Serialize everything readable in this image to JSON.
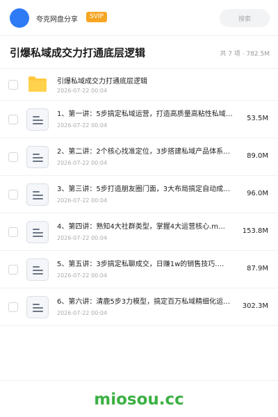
{
  "header": {
    "username": "夸克网盘分享",
    "badge": "SVIP",
    "search_placeholder": "搜索"
  },
  "folder": {
    "title": "引爆私域成交力打通底层逻辑",
    "summary": "共 7 项 · 782.5M"
  },
  "files": [
    {
      "icon": "folder-icon",
      "name": "引爆私域成交力打通底层逻辑",
      "date": "2026-07-22 00:04",
      "size": ""
    },
    {
      "icon": "document-icon",
      "name": "1、第一讲：5步搞定私域运营，打造高质量高粘性私域…",
      "date": "2026-07-22 00:04",
      "size": "53.5M"
    },
    {
      "icon": "document-icon",
      "name": "2、第二讲：2个核心找准定位，3步搭建私域产品体系…",
      "date": "2026-07-22 00:04",
      "size": "89.0M"
    },
    {
      "icon": "document-icon",
      "name": "3、第三讲：5步打造朋友圈门面，3大布局搞定自动成…",
      "date": "2026-07-22 00:04",
      "size": "96.0M"
    },
    {
      "icon": "document-icon",
      "name": "4、第四讲：熟知4大社群类型，掌握4大运营核心.m…",
      "date": "2026-07-22 00:04",
      "size": "153.8M"
    },
    {
      "icon": "document-icon",
      "name": "5、第五讲：3步搞定私聊成交，日赚1w的销售技巧.…",
      "date": "2026-07-22 00:04",
      "size": "87.9M"
    },
    {
      "icon": "document-icon",
      "name": "6、第六讲：清鹿5步3力模型，搞定百万私域精细化运…",
      "date": "2026-07-22 00:04",
      "size": "302.3M"
    }
  ],
  "watermark": "miosou.cc",
  "colors": {
    "accent_blue": "#2f7bf6",
    "svip_orange": "#f6a623",
    "folder_yellow": "#ffc83d",
    "watermark_green": "#3cb043"
  }
}
